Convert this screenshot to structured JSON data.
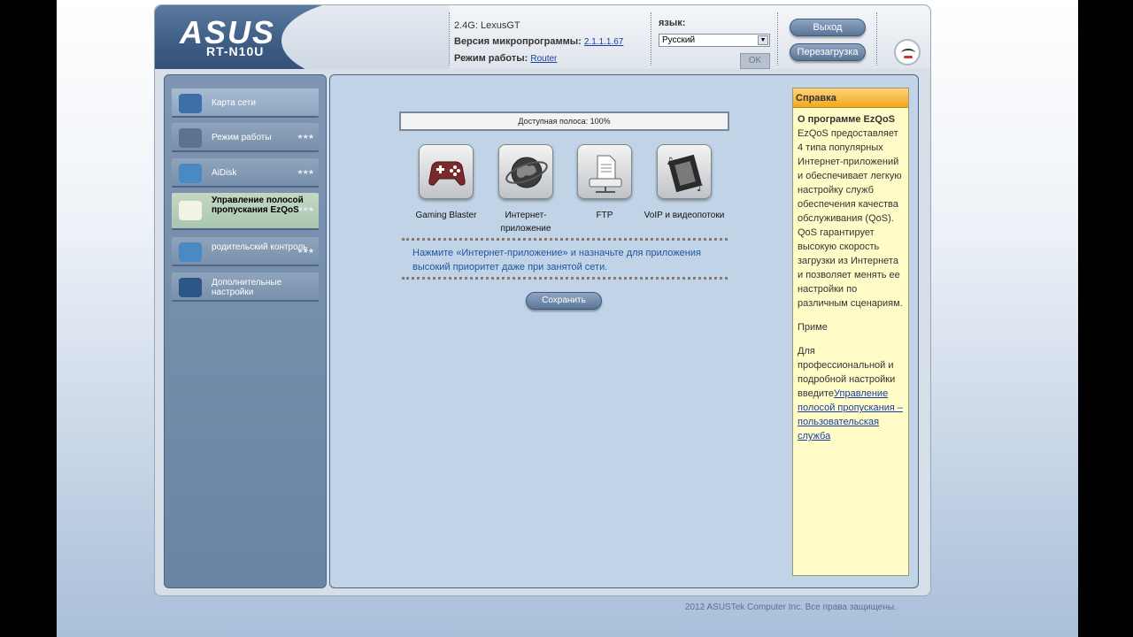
{
  "header": {
    "brand": "ASUS",
    "model": "RT-N10U",
    "ssid_label": "2.4G:",
    "ssid_value": "LexusGT",
    "firmware_label": "Версия микропрограммы:",
    "firmware_value": "2.1.1.1.67",
    "mode_label": "Режим работы:",
    "mode_value": "Router",
    "language_label": "язык:",
    "language_selected": "Русский",
    "ok_label": "OK",
    "logout_label": "Выход",
    "reboot_label": "Перезагрузка"
  },
  "sidebar": {
    "items": [
      {
        "label": "Карта сети",
        "icon": "network-map-icon",
        "state": "normal",
        "stars": false
      },
      {
        "label": "Режим работы",
        "icon": "operation-mode-icon",
        "state": "dim",
        "stars": true
      },
      {
        "label": "AiDisk",
        "icon": "aidisk-icon",
        "state": "dim",
        "stars": true
      },
      {
        "label": "Управление полосой пропускания EzQoS",
        "icon": "bandwidth-icon",
        "state": "active",
        "stars": true
      },
      {
        "label": "родительский контроль",
        "icon": "parental-control-icon",
        "state": "dim",
        "stars": true
      },
      {
        "label": "Дополнительные настройки",
        "icon": "advanced-settings-icon",
        "state": "dim",
        "stars": false
      }
    ],
    "stars_glyph": "★★★"
  },
  "main": {
    "bandwidth_text": "Доступная полоса: 100%",
    "apps": [
      {
        "label": "Gaming Blaster",
        "icon": "gamepad-icon"
      },
      {
        "label": "Интернет-приложение",
        "icon": "globe-icon"
      },
      {
        "label": "FTP",
        "icon": "ftp-icon"
      },
      {
        "label": "VoIP и видеопотоки",
        "icon": "film-icon"
      }
    ],
    "hint": "Нажмите «Интернет-приложение» и назначьте для приложения высокий приоритет даже при занятой сети.",
    "save_label": "Сохранить"
  },
  "help": {
    "heading": "Справка",
    "title": "О программе EzQoS",
    "paragraph1": "EzQoS предоставляет 4 типа популярных Интернет-приложений и обеспечивает легкую настройку служб обеспечения качества обслуживания (QoS). QoS гарантирует высокую скорость загрузки из Интернета и позволяет менять ее настройки по различным сценариям.",
    "paragraph2": "Приме",
    "paragraph3_prefix": "Для профессиональной и подробной настройки введите",
    "paragraph3_link": "Управление полосой пропускания – пользовательская служба"
  },
  "footer": "2012 ASUSTek Computer Inc. Все права защищены.",
  "colors": {
    "accent": "#1e56a0",
    "help_bg": "#fffcc8",
    "main_bg": "#c1d4e7"
  }
}
